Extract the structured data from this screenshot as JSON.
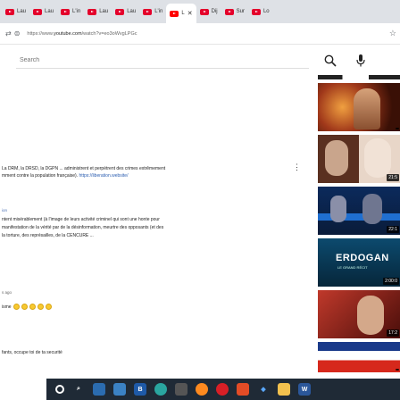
{
  "tabs": [
    {
      "label": "Lau",
      "favicon": "le-monde-favicon"
    },
    {
      "label": "Lau",
      "favicon": "le-monde-favicon"
    },
    {
      "label": "L'in",
      "favicon": "le-monde-favicon"
    },
    {
      "label": "Lau",
      "favicon": "le-monde-favicon"
    },
    {
      "label": "Lau",
      "favicon": "le-monde-favicon"
    },
    {
      "label": "L'in",
      "favicon": "le-monde-favicon"
    },
    {
      "label": "L",
      "favicon": "youtube-favicon",
      "active": true
    },
    {
      "label": "Dij",
      "favicon": "le-monde-favicon"
    },
    {
      "label": "Sur",
      "favicon": "le-monde-favicon"
    },
    {
      "label": "Lo",
      "favicon": "le-monde-favicon"
    }
  ],
  "address": {
    "prefix": "https://www.",
    "host": "youtube.com",
    "path": "/watch?v=eo3oWvgLPGc"
  },
  "search": {
    "placeholder": "Search"
  },
  "comments": {
    "c1_line1": "La DRM, la DRSD, la DGPN ... administrent et perpètrent des crimes extrêmement",
    "c1_line2": "mment contre la population française).",
    "c1_link": "https://liberation.website/",
    "c2_meta": "ion",
    "c2_line1": "ntent misérablement (à l'image de leurs activité criminel qui sont une honte pour",
    "c2_line2": "manifestation de la vérité par de la désinformation, meurtre des opposants (et des",
    "c2_line3": "la torture, des représailles, de la CENCURE ...",
    "c3_meta": "s ago",
    "c3_text": "isme",
    "c4_text": "fants, occupe toi de ta securité"
  },
  "thumbnails": [
    {
      "duration": "",
      "palette": "fire-portrait"
    },
    {
      "duration": "21:5",
      "palette": "chat-faces"
    },
    {
      "duration": "22:1",
      "palette": "studio-blue"
    },
    {
      "duration": "2:00:0",
      "palette": "erdogan",
      "title": "ERDOGAN",
      "subtitle": "LE GRAND RÉCIT"
    },
    {
      "duration": "17:2",
      "palette": "portrait-red"
    },
    {
      "duration": "",
      "palette": "flag-stripes"
    }
  ],
  "taskbar": {
    "items": [
      "start-icon",
      "search-icon",
      "taskview-icon",
      "explorer-icon",
      "b-app-icon",
      "edge-icon",
      "store-icon",
      "firefox-icon",
      "opera-icon",
      "media-icon",
      "dropbox-icon",
      "folder-icon",
      "word-icon"
    ]
  },
  "colors": {
    "youtube_red": "#ff0000",
    "link_blue": "#2a5db0",
    "taskbar": "#1f2a36"
  }
}
